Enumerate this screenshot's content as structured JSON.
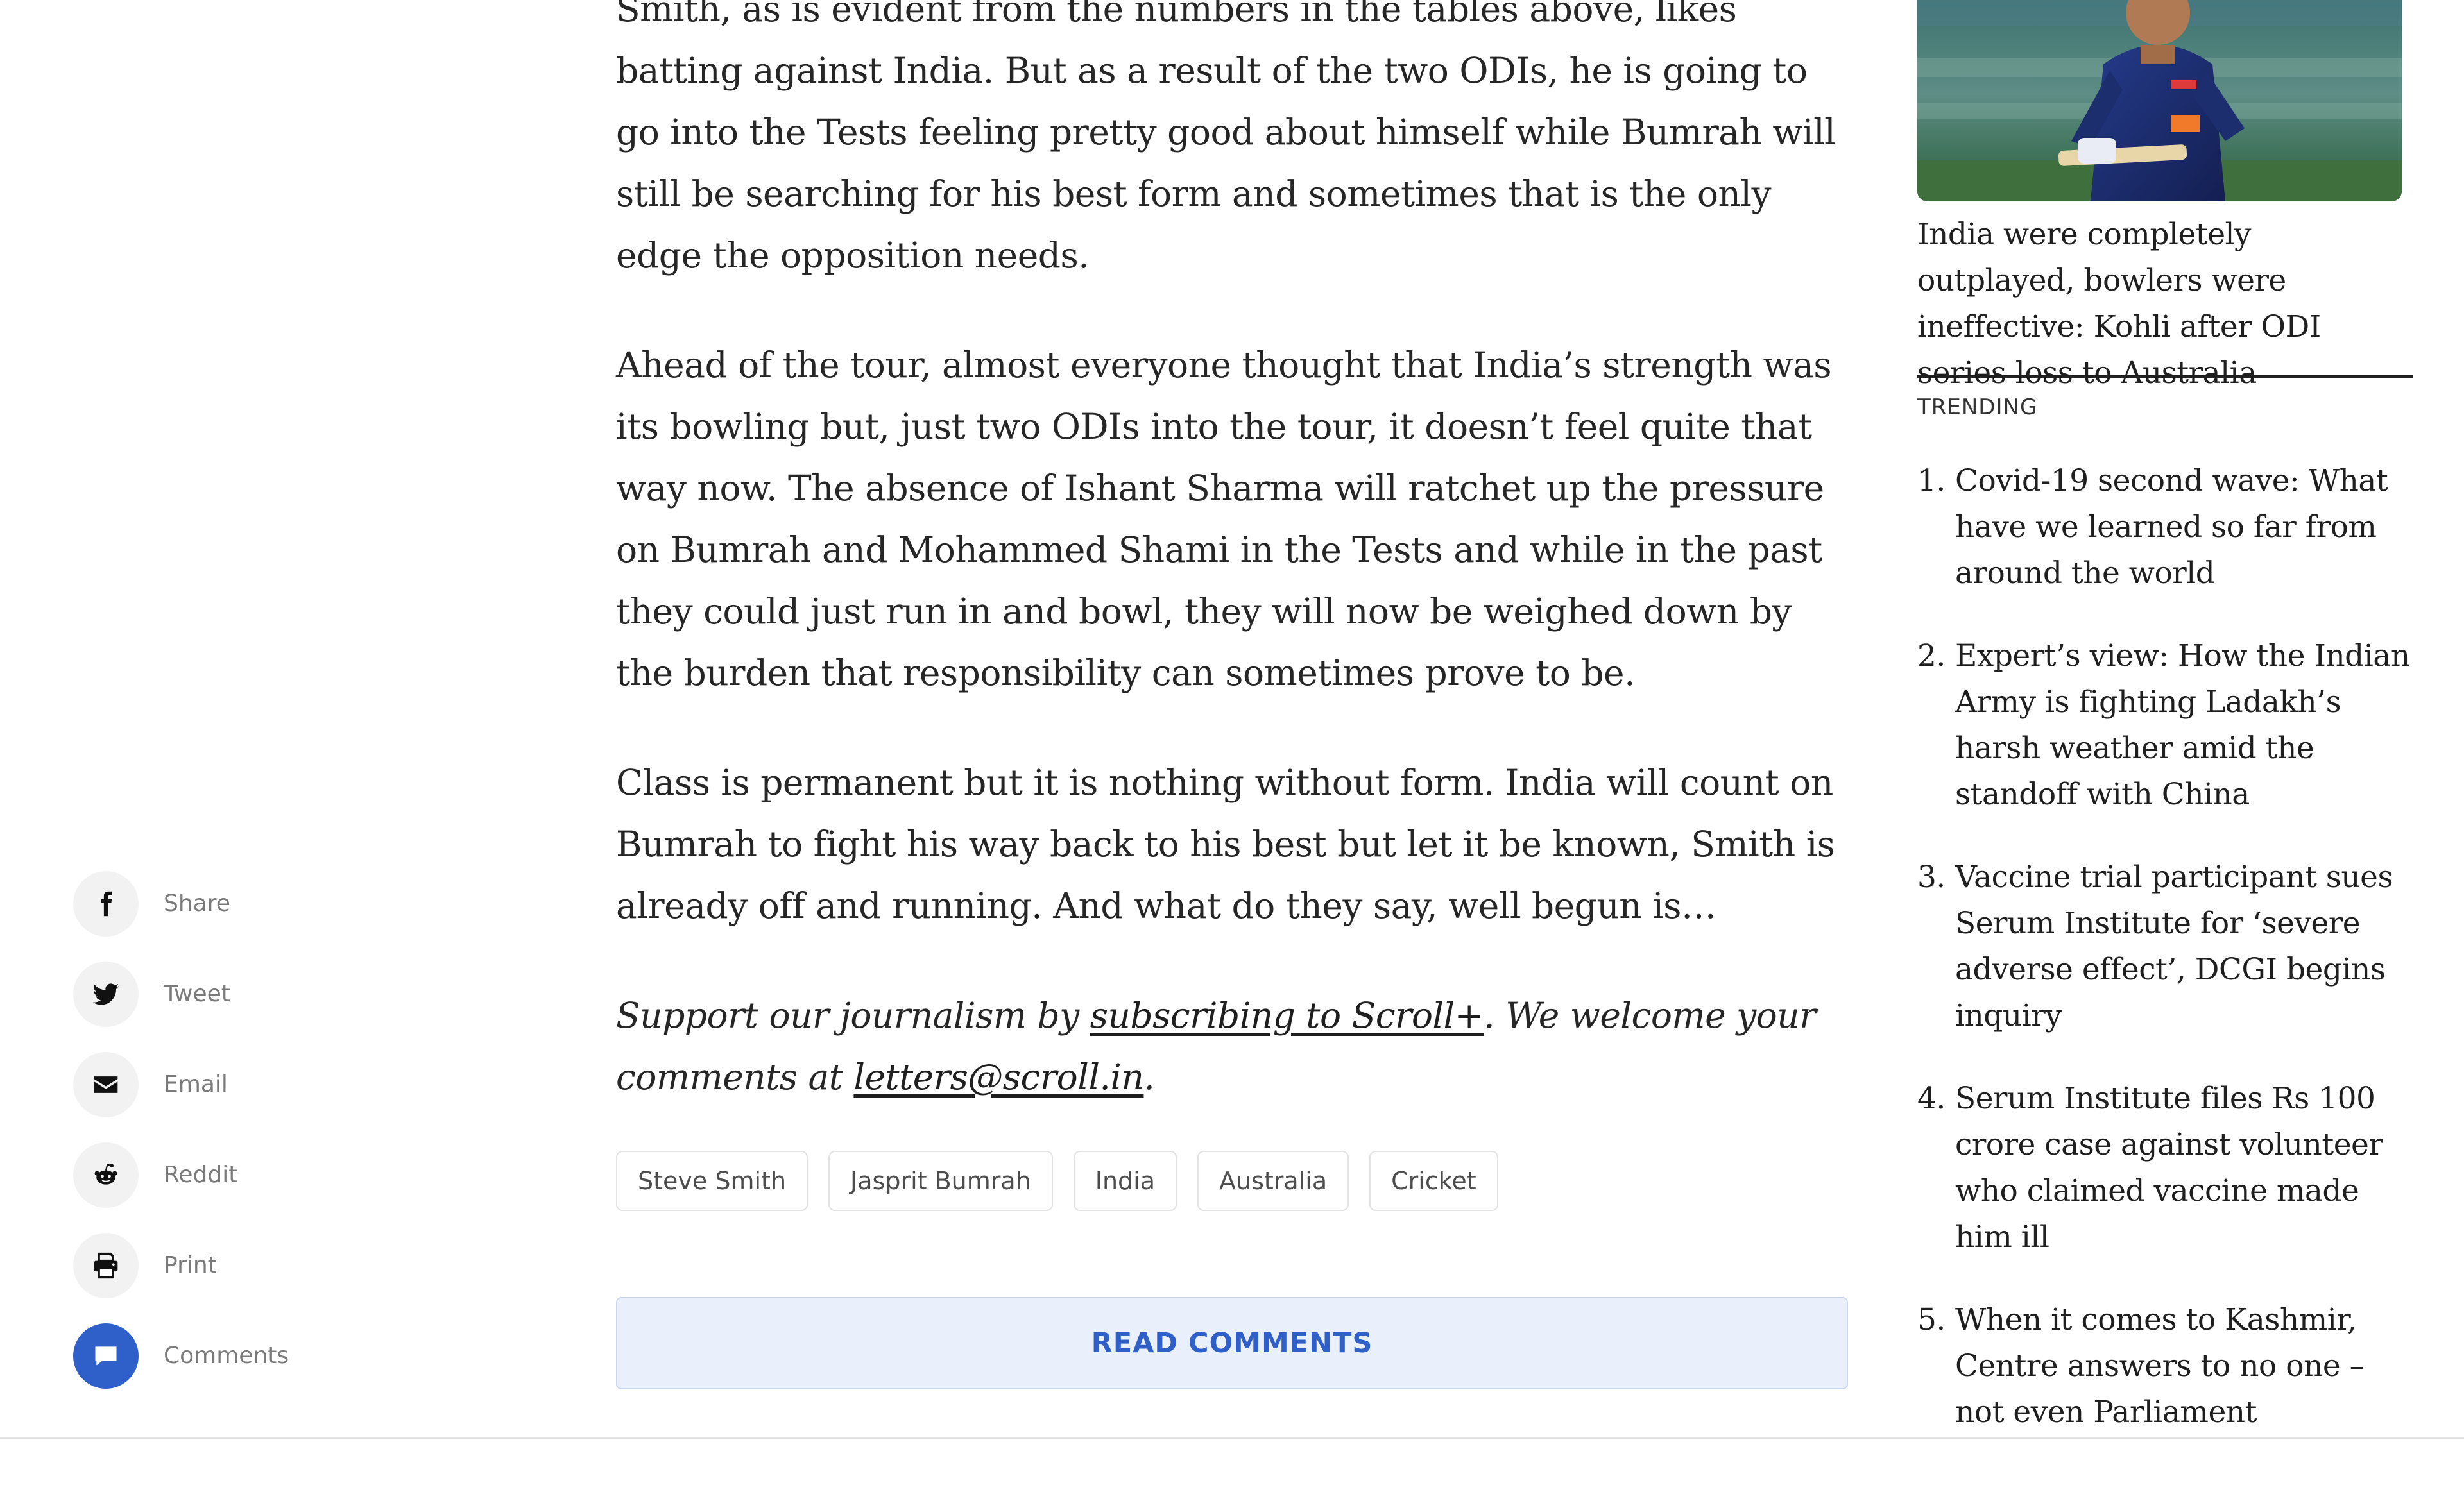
{
  "share": {
    "items": [
      {
        "key": "facebook",
        "label": "Share",
        "icon": "facebook-icon"
      },
      {
        "key": "twitter",
        "label": "Tweet",
        "icon": "twitter-icon"
      },
      {
        "key": "email",
        "label": "Email",
        "icon": "envelope-icon"
      },
      {
        "key": "reddit",
        "label": "Reddit",
        "icon": "reddit-icon"
      },
      {
        "key": "print",
        "label": "Print",
        "icon": "printer-icon"
      },
      {
        "key": "comments",
        "label": "Comments",
        "icon": "comment-icon",
        "active_color": "#2f5fc8"
      }
    ]
  },
  "article": {
    "paragraphs": [
      "Smith, as is evident from the numbers in the tables above, likes batting against India. But as a result of the two ODIs, he is going to go into the Tests feeling pretty good about himself while Bumrah will still be searching for his best form and sometimes that is the only edge the opposition needs.",
      "Ahead of the tour, almost everyone thought that India’s strength was its bowling but, just two ODIs into the tour, it doesn’t feel quite that way now. The absence of Ishant Sharma will ratchet up the pressure on Bumrah and Mohammed Shami in the Tests and while in the past they could just run in and bowl, they will now be weighed down by the burden that responsibility can sometimes prove to be.",
      "Class is permanent but it is nothing without form. India will count on Bumrah to fight his way back to his best but let it be known, Smith is already off and running. And what do they say, well begun is…"
    ],
    "support": {
      "prefix": "Support our journalism by ",
      "link1": "subscribing to Scroll+",
      "middle": ". We welcome your comments at ",
      "link2": "letters@scroll.in",
      "suffix": "."
    },
    "tags": [
      "Steve Smith",
      "Jasprit Bumrah",
      "India",
      "Australia",
      "Cricket"
    ],
    "read_comments_label": "READ COMMENTS"
  },
  "sidebar": {
    "feature_caption": "India were completely outplayed, bowlers were ineffective: Kohli after ODI series loss to Australia",
    "trending_title": "TRENDING",
    "trending": [
      {
        "num": "1.",
        "title": "Covid-19 second wave: What have we learned so far from around the world"
      },
      {
        "num": "2.",
        "title": "Expert’s view: How the Indian Army is fighting Ladakh’s harsh weather amid the standoff with China"
      },
      {
        "num": "3.",
        "title": "Vaccine trial participant sues Serum Institute for ‘severe adverse effect’, DCGI begins inquiry"
      },
      {
        "num": "4.",
        "title": "Serum Institute files Rs 100 crore case against volunteer who claimed vaccine made him ill"
      },
      {
        "num": "5.",
        "title": "When it comes to Kashmir, Centre answers to no one – not even Parliament"
      }
    ]
  }
}
